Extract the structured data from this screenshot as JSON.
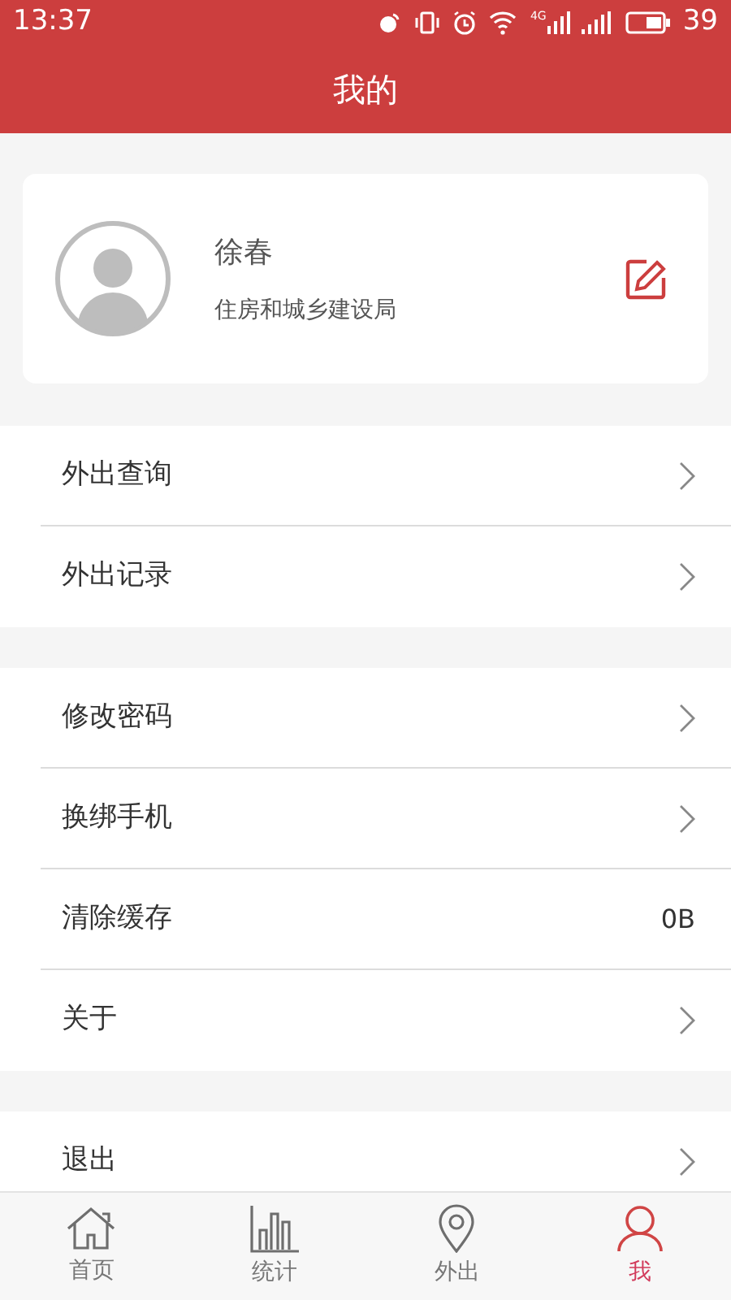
{
  "status_bar": {
    "time": "13:37",
    "network": "4G",
    "battery": "39"
  },
  "header": {
    "title": "我的"
  },
  "profile": {
    "name": "徐春",
    "department": "住房和城乡建设局"
  },
  "menu_groups": [
    [
      {
        "kind": "link",
        "label": "外出查询"
      },
      {
        "kind": "link",
        "label": "外出记录"
      }
    ],
    [
      {
        "kind": "link",
        "label": "修改密码"
      },
      {
        "kind": "link",
        "label": "换绑手机"
      },
      {
        "kind": "value",
        "label": "清除缓存",
        "value": "0B"
      },
      {
        "kind": "link",
        "label": "关于"
      }
    ],
    [
      {
        "kind": "link",
        "label": "退出"
      }
    ]
  ],
  "tab_bar": [
    {
      "kind": "home",
      "label": "首页",
      "selected": false
    },
    {
      "kind": "stats",
      "label": "统计",
      "selected": false
    },
    {
      "kind": "location",
      "label": "外出",
      "selected": false
    },
    {
      "kind": "person",
      "label": "我",
      "selected": true
    }
  ]
}
